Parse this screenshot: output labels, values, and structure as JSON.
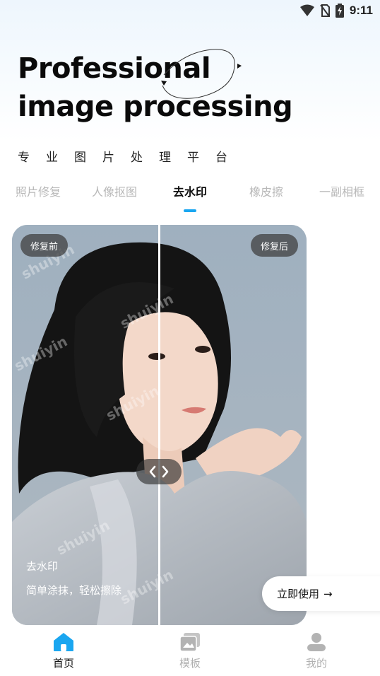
{
  "status_bar": {
    "time": "9:11",
    "icons": [
      "wifi-icon",
      "no-sim-icon",
      "battery-charging-icon"
    ]
  },
  "hero": {
    "title_line1": "Professional",
    "title_line2": "image processing",
    "subtitle": "专业图片处理平台"
  },
  "tabs": [
    {
      "label": "照片修复",
      "active": false
    },
    {
      "label": "人像抠图",
      "active": false
    },
    {
      "label": "去水印",
      "active": true
    },
    {
      "label": "橡皮擦",
      "active": false
    },
    {
      "label": "一副相框",
      "active": false
    }
  ],
  "card": {
    "before_label": "修复前",
    "after_label": "修复后",
    "feature_title": "去水印",
    "feature_desc": "简单涂抹，轻松擦除",
    "watermark_text": "shuiyin",
    "use_button_label": "立即使用",
    "use_button_arrow": "→",
    "compare_handle_icons": [
      "chevron-left-icon",
      "chevron-right-icon"
    ]
  },
  "bottom_nav": [
    {
      "label": "首页",
      "icon": "home-icon",
      "active": true
    },
    {
      "label": "模板",
      "icon": "template-icon",
      "active": false
    },
    {
      "label": "我的",
      "icon": "profile-icon",
      "active": false
    }
  ],
  "colors": {
    "accent": "#1aa6f0",
    "inactive": "#b8b8b8",
    "text": "#111111"
  }
}
